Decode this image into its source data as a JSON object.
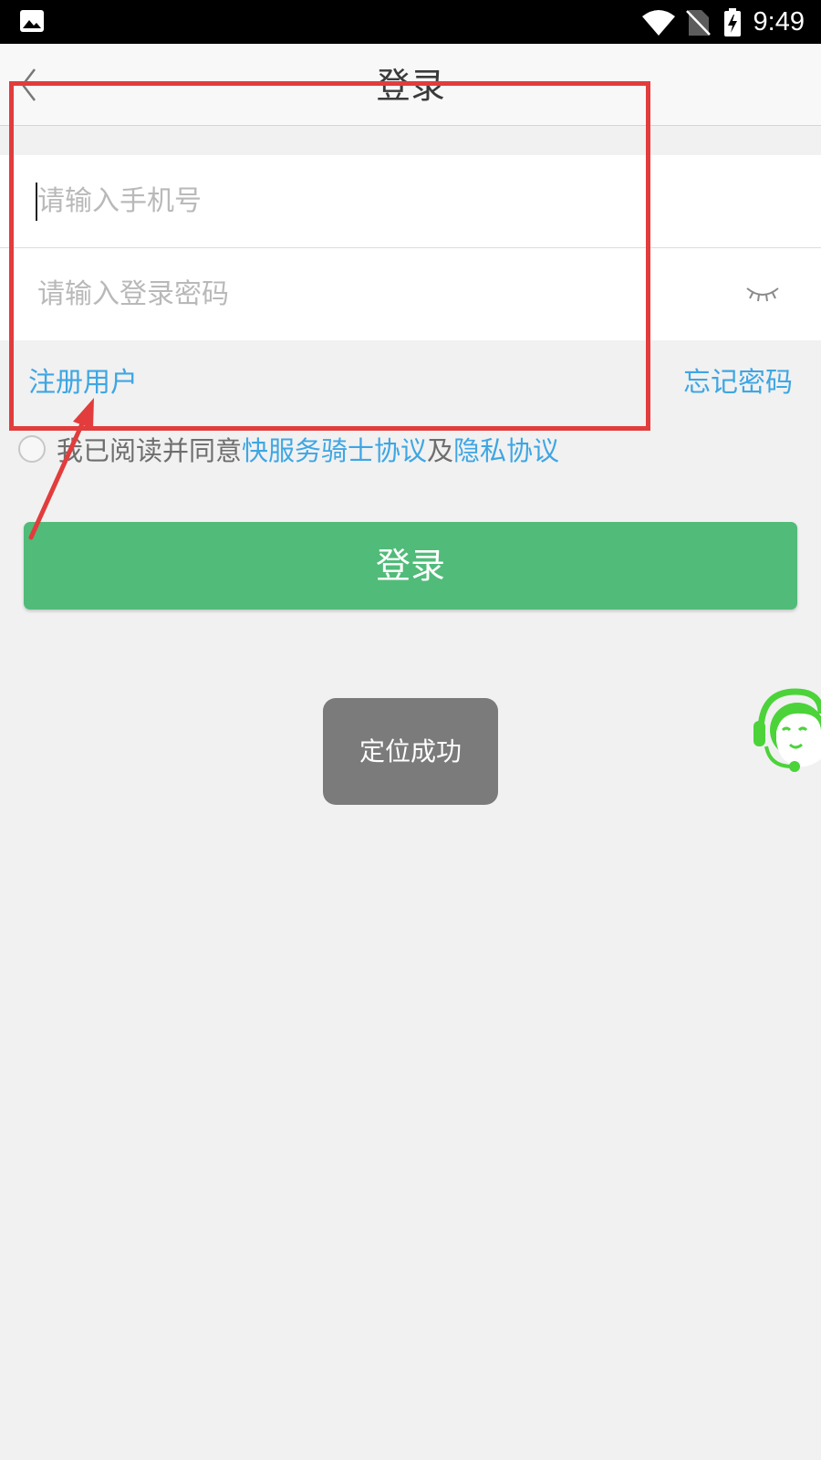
{
  "status_bar": {
    "time": "9:49",
    "icons": [
      "gallery-icon",
      "wifi-icon",
      "no-sim-icon",
      "battery-charging-icon"
    ]
  },
  "header": {
    "title": "登录",
    "back_icon": "chevron-left-icon"
  },
  "form": {
    "phone_placeholder": "请输入手机号",
    "phone_value": "",
    "password_placeholder": "请输入登录密码",
    "password_value": "",
    "password_toggle_icon": "eye-closed-icon"
  },
  "links": {
    "register": "注册用户",
    "forgot_password": "忘记密码"
  },
  "agreement": {
    "checked": false,
    "prefix": "我已阅读并同意",
    "service_link": "快服务骑士协议",
    "joiner": "及",
    "privacy_link": "隐私协议"
  },
  "login_button": "登录",
  "toast": "定位成功",
  "support": {
    "icon": "customer-service-headset-icon"
  },
  "colors": {
    "primary_green": "#51bb79",
    "link_blue": "#3ea6e3",
    "annotation_red": "#e23c3c",
    "support_green": "#4cd33a",
    "toast_gray": "#7b7b7b"
  }
}
